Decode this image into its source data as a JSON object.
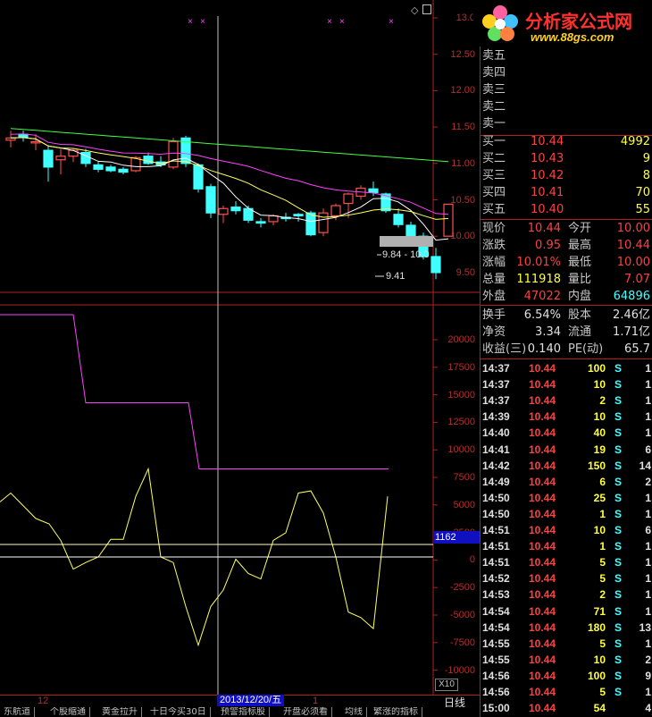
{
  "logo": {
    "title": "分析家公式网",
    "url": "www.88gs.com"
  },
  "price_axis": [
    "13.0",
    "12.50",
    "12.00",
    "11.50",
    "11.00",
    "10.50",
    "10.00",
    "9.50"
  ],
  "indicator_axis": [
    "20000",
    "17500",
    "15000",
    "12500",
    "10000",
    "7500",
    "5000",
    "2500",
    "0",
    "-2500",
    "-5000",
    "-7500",
    "-10000"
  ],
  "annotations": {
    "range_label": "9.84 - 10.0",
    "low_label": "9.41",
    "level_box": "1162",
    "zoom_box": "X10"
  },
  "time_axis": {
    "month_label": "12",
    "date_label": "2013/12/20/五",
    "next_label": "1",
    "period": "日线"
  },
  "bottom_tabs": [
    "东航道",
    "个股缩通",
    "黄金拉升",
    "十日今买30日",
    "预警指标股",
    "开盘必须看",
    "均线",
    "繁涨的指标"
  ],
  "sell_orders": [
    {
      "label": "卖五"
    },
    {
      "label": "卖四"
    },
    {
      "label": "卖三"
    },
    {
      "label": "卖二"
    },
    {
      "label": "卖一"
    }
  ],
  "buy_orders": [
    {
      "label": "买一",
      "price": "10.44",
      "vol": "4992"
    },
    {
      "label": "买二",
      "price": "10.43",
      "vol": "9"
    },
    {
      "label": "买三",
      "price": "10.42",
      "vol": "8"
    },
    {
      "label": "买四",
      "price": "10.41",
      "vol": "70"
    },
    {
      "label": "买五",
      "price": "10.40",
      "vol": "55"
    }
  ],
  "quote": {
    "now_label": "现价",
    "now": "10.44",
    "open_label": "今开",
    "open": "10.00",
    "chg_label": "涨跌",
    "chg": "0.95",
    "high_label": "最高",
    "high": "10.44",
    "pct_label": "涨幅",
    "pct": "10.01%",
    "low_label": "最低",
    "low": "10.00",
    "vol_label": "总量",
    "vol": "111918",
    "ratio_label": "量比",
    "ratio": "7.07",
    "outer_label": "外盘",
    "outer": "47022",
    "inner_label": "内盘",
    "inner": "64896",
    "turn_label": "换手",
    "turn": "6.54%",
    "equity_label": "股本",
    "equity": "2.46亿",
    "nav_label": "净资",
    "nav": "3.34",
    "float_label": "流通",
    "float": "1.71亿",
    "eps_label": "收益(三)",
    "eps": "0.140",
    "pe_label": "PE(动)",
    "pe": "65.7"
  },
  "ticks": [
    {
      "time": "14:37",
      "price": "10.44",
      "vol": "100",
      "side": "S",
      "n": "1"
    },
    {
      "time": "14:37",
      "price": "10.44",
      "vol": "10",
      "side": "S",
      "n": "1"
    },
    {
      "time": "14:37",
      "price": "10.44",
      "vol": "2",
      "side": "S",
      "n": "1"
    },
    {
      "time": "14:39",
      "price": "10.44",
      "vol": "10",
      "side": "S",
      "n": "1"
    },
    {
      "time": "14:40",
      "price": "10.44",
      "vol": "40",
      "side": "S",
      "n": "1"
    },
    {
      "time": "14:41",
      "price": "10.44",
      "vol": "19",
      "side": "S",
      "n": "6"
    },
    {
      "time": "14:42",
      "price": "10.44",
      "vol": "150",
      "side": "S",
      "n": "14"
    },
    {
      "time": "14:49",
      "price": "10.44",
      "vol": "6",
      "side": "S",
      "n": "2"
    },
    {
      "time": "14:50",
      "price": "10.44",
      "vol": "25",
      "side": "S",
      "n": "1"
    },
    {
      "time": "14:50",
      "price": "10.44",
      "vol": "1",
      "side": "S",
      "n": "1"
    },
    {
      "time": "14:51",
      "price": "10.44",
      "vol": "10",
      "side": "S",
      "n": "6"
    },
    {
      "time": "14:51",
      "price": "10.44",
      "vol": "1",
      "side": "S",
      "n": "1"
    },
    {
      "time": "14:51",
      "price": "10.44",
      "vol": "5",
      "side": "S",
      "n": "1"
    },
    {
      "time": "14:52",
      "price": "10.44",
      "vol": "5",
      "side": "S",
      "n": "1"
    },
    {
      "time": "14:53",
      "price": "10.44",
      "vol": "2",
      "side": "S",
      "n": "1"
    },
    {
      "time": "14:54",
      "price": "10.44",
      "vol": "71",
      "side": "S",
      "n": "1"
    },
    {
      "time": "14:54",
      "price": "10.44",
      "vol": "180",
      "side": "S",
      "n": "13"
    },
    {
      "time": "14:55",
      "price": "10.44",
      "vol": "5",
      "side": "S",
      "n": "1"
    },
    {
      "time": "14:55",
      "price": "10.44",
      "vol": "10",
      "side": "S",
      "n": "2"
    },
    {
      "time": "14:56",
      "price": "10.44",
      "vol": "100",
      "side": "S",
      "n": "9"
    },
    {
      "time": "14:56",
      "price": "10.44",
      "vol": "5",
      "side": "S",
      "n": "1"
    },
    {
      "time": "15:00",
      "price": "10.44",
      "vol": "54",
      "side": "",
      "n": "4"
    }
  ],
  "colors": {
    "up": "#ff5050",
    "down": "#40ffff",
    "ma5": "#ffffff",
    "ma10": "#ffff60",
    "ma20": "#ff40ff",
    "ma60": "#40ff40",
    "frame": "#b02020"
  }
}
